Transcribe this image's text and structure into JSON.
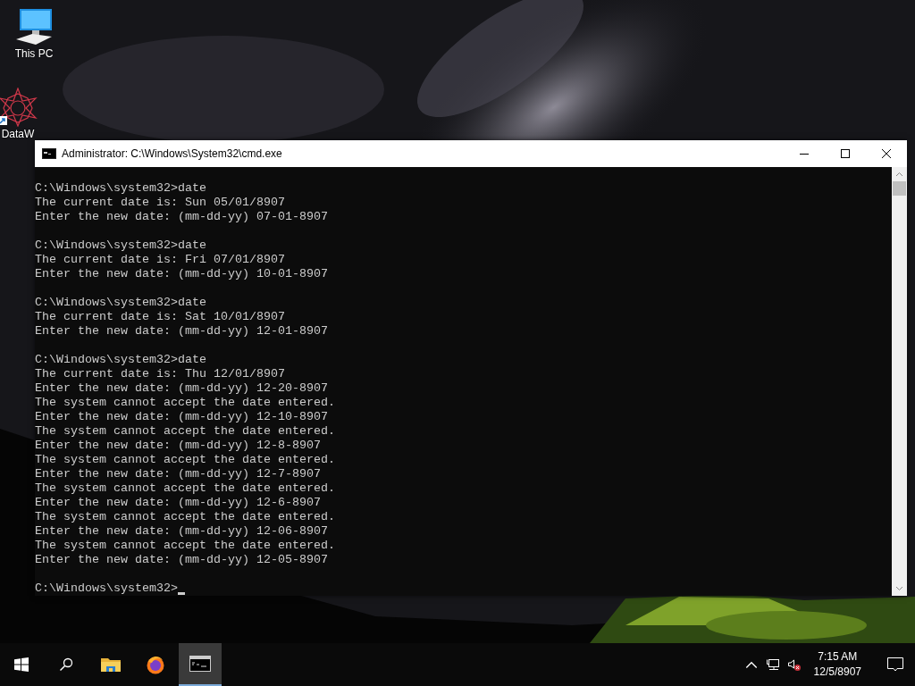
{
  "desktop_icons": [
    {
      "label": "This PC",
      "kind": "computer"
    },
    {
      "label": "DataW",
      "kind": "shortcut"
    }
  ],
  "window": {
    "title": "Administrator: C:\\Windows\\System32\\cmd.exe",
    "console": {
      "blocks": [
        [
          "C:\\Windows\\system32>date",
          "The current date is: Sun 05/01/8907",
          "Enter the new date: (mm-dd-yy) 07-01-8907"
        ],
        [
          "C:\\Windows\\system32>date",
          "The current date is: Fri 07/01/8907",
          "Enter the new date: (mm-dd-yy) 10-01-8907"
        ],
        [
          "C:\\Windows\\system32>date",
          "The current date is: Sat 10/01/8907",
          "Enter the new date: (mm-dd-yy) 12-01-8907"
        ],
        [
          "C:\\Windows\\system32>date",
          "The current date is: Thu 12/01/8907",
          "Enter the new date: (mm-dd-yy) 12-20-8907",
          "The system cannot accept the date entered.",
          "Enter the new date: (mm-dd-yy) 12-10-8907",
          "The system cannot accept the date entered.",
          "Enter the new date: (mm-dd-yy) 12-8-8907",
          "The system cannot accept the date entered.",
          "Enter the new date: (mm-dd-yy) 12-7-8907",
          "The system cannot accept the date entered.",
          "Enter the new date: (mm-dd-yy) 12-6-8907",
          "The system cannot accept the date entered.",
          "Enter the new date: (mm-dd-yy) 12-06-8907",
          "The system cannot accept the date entered.",
          "Enter the new date: (mm-dd-yy) 12-05-8907"
        ]
      ],
      "prompt": "C:\\Windows\\system32>"
    }
  },
  "taskbar": {
    "apps": [
      {
        "kind": "start",
        "selected": false
      },
      {
        "kind": "search",
        "selected": false
      },
      {
        "kind": "explorer",
        "selected": false
      },
      {
        "kind": "firefox",
        "selected": false
      },
      {
        "kind": "cmd",
        "selected": true
      }
    ],
    "time": "7:15 AM",
    "date": "12/5/8907"
  }
}
